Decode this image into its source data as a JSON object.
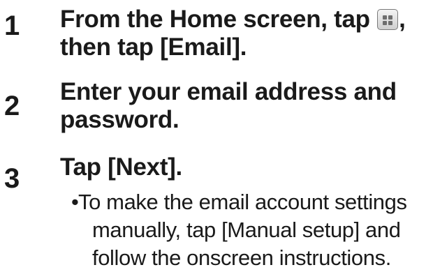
{
  "steps": [
    {
      "number": "1",
      "line1_before_icon": "From the Home screen, tap ",
      "line1_after_icon": ",",
      "line2": "then tap [Email]."
    },
    {
      "number": "2",
      "line1": "Enter your email address and",
      "line2": "password."
    },
    {
      "number": "3",
      "line1": "Tap [Next]."
    }
  ],
  "note": {
    "bullet": "•",
    "line1": "To make the email account settings",
    "line2": "manually, tap [Manual setup] and",
    "line3": "follow the onscreen instructions."
  },
  "icons": {
    "apps_icon": "apps-grid-icon"
  }
}
